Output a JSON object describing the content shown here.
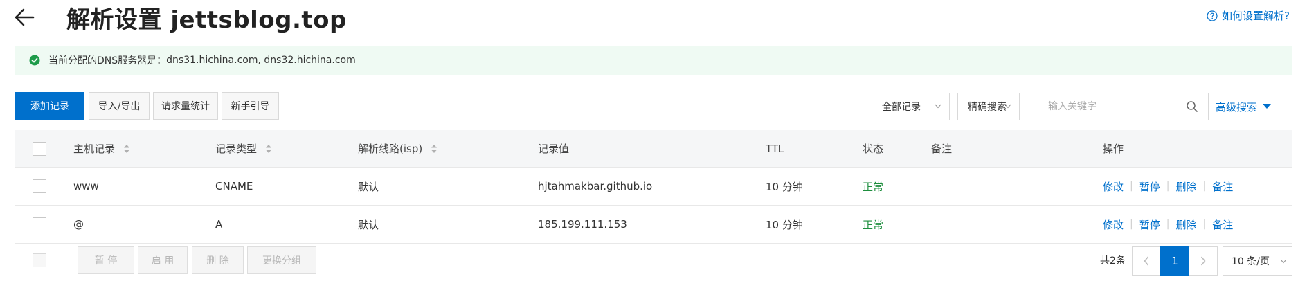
{
  "header": {
    "title": "解析设置 jettsblog.top",
    "help_link": "如何设置解析?"
  },
  "notice": {
    "label": "当前分配的DNS服务器是：",
    "servers": "dns31.hichina.com, dns32.hichina.com"
  },
  "toolbar": {
    "add_record": "添加记录",
    "import_export": "导入/导出",
    "request_stats": "请求量统计",
    "beginner_guide": "新手引导",
    "filter_select": "全部记录",
    "search_mode": "精确搜索",
    "search_placeholder": "输入关键字",
    "advanced_search": "高级搜索"
  },
  "table": {
    "columns": {
      "host": "主机记录",
      "type": "记录类型",
      "line": "解析线路(isp)",
      "value": "记录值",
      "ttl": "TTL",
      "status": "状态",
      "remark": "备注",
      "actions": "操作"
    },
    "rows": [
      {
        "host": "www",
        "type": "CNAME",
        "line": "默认",
        "value": "hjtahmakbar.github.io",
        "ttl": "10 分钟",
        "status": "正常",
        "remark": ""
      },
      {
        "host": "@",
        "type": "A",
        "line": "默认",
        "value": "185.199.111.153",
        "ttl": "10 分钟",
        "status": "正常",
        "remark": ""
      }
    ],
    "row_actions": [
      "修改",
      "暂停",
      "删除",
      "备注"
    ]
  },
  "footer": {
    "pause": "暂 停",
    "enable": "启 用",
    "delete": "删 除",
    "change_group": "更换分组",
    "total": "共2条",
    "current_page": "1",
    "page_size": "10 条/页"
  },
  "colors": {
    "primary": "#0070cc",
    "success": "#1e8e3e",
    "notice_bg": "#effaf3"
  }
}
